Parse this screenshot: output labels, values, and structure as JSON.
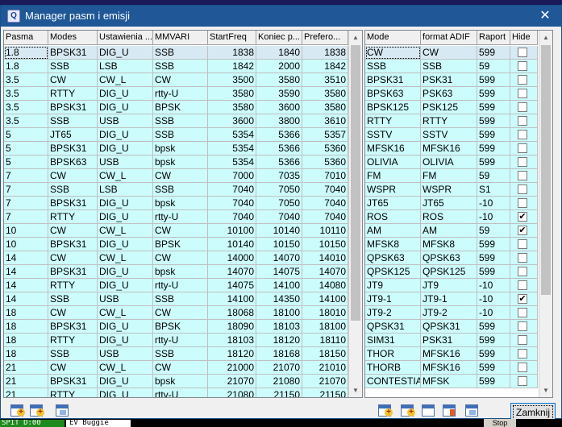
{
  "window": {
    "title": "Manager pasm i emisji"
  },
  "background": {
    "status_left": "SPIT D:00",
    "status_mid": "EV Buggie",
    "status_right": "Stop"
  },
  "left_table": {
    "columns": [
      "Pasma",
      "Modes",
      "Ustawienia ...",
      "MMVARI",
      "StartFreq",
      "Koniec p...",
      "Prefero..."
    ],
    "rows": [
      [
        "1.8",
        "BPSK31",
        "DIG_U",
        "SSB",
        "1838",
        "1840",
        "1838"
      ],
      [
        "1.8",
        "SSB",
        "LSB",
        "SSB",
        "1842",
        "2000",
        "1842"
      ],
      [
        "3.5",
        "CW",
        "CW_L",
        "CW",
        "3500",
        "3580",
        "3510"
      ],
      [
        "3.5",
        "RTTY",
        "DIG_U",
        "rtty-U",
        "3580",
        "3590",
        "3580"
      ],
      [
        "3.5",
        "BPSK31",
        "DIG_U",
        "BPSK",
        "3580",
        "3600",
        "3580"
      ],
      [
        "3.5",
        "SSB",
        "USB",
        "SSB",
        "3600",
        "3800",
        "3610"
      ],
      [
        "5",
        "JT65",
        "DIG_U",
        "SSB",
        "5354",
        "5366",
        "5357"
      ],
      [
        "5",
        "BPSK31",
        "DIG_U",
        "bpsk",
        "5354",
        "5366",
        "5360"
      ],
      [
        "5",
        "BPSK63",
        "USB",
        "bpsk",
        "5354",
        "5366",
        "5360"
      ],
      [
        "7",
        "CW",
        "CW_L",
        "CW",
        "7000",
        "7035",
        "7010"
      ],
      [
        "7",
        "SSB",
        "LSB",
        "SSB",
        "7040",
        "7050",
        "7040"
      ],
      [
        "7",
        "BPSK31",
        "DIG_U",
        "bpsk",
        "7040",
        "7050",
        "7040"
      ],
      [
        "7",
        "RTTY",
        "DIG_U",
        "rtty-U",
        "7040",
        "7040",
        "7040"
      ],
      [
        "10",
        "CW",
        "CW_L",
        "CW",
        "10100",
        "10140",
        "10110"
      ],
      [
        "10",
        "BPSK31",
        "DIG_U",
        "BPSK",
        "10140",
        "10150",
        "10150"
      ],
      [
        "14",
        "CW",
        "CW_L",
        "CW",
        "14000",
        "14070",
        "14010"
      ],
      [
        "14",
        "BPSK31",
        "DIG_U",
        "bpsk",
        "14070",
        "14075",
        "14070"
      ],
      [
        "14",
        "RTTY",
        "DIG_U",
        "rtty-U",
        "14075",
        "14100",
        "14080"
      ],
      [
        "14",
        "SSB",
        "USB",
        "SSB",
        "14100",
        "14350",
        "14100"
      ],
      [
        "18",
        "CW",
        "CW_L",
        "CW",
        "18068",
        "18100",
        "18010"
      ],
      [
        "18",
        "BPSK31",
        "DIG_U",
        "BPSK",
        "18090",
        "18103",
        "18100"
      ],
      [
        "18",
        "RTTY",
        "DIG_U",
        "rtty-U",
        "18103",
        "18120",
        "18110"
      ],
      [
        "18",
        "SSB",
        "USB",
        "SSB",
        "18120",
        "18168",
        "18150"
      ],
      [
        "21",
        "CW",
        "CW_L",
        "CW",
        "21000",
        "21070",
        "21010"
      ],
      [
        "21",
        "BPSK31",
        "DIG_U",
        "bpsk",
        "21070",
        "21080",
        "21070"
      ],
      [
        "21",
        "RTTY",
        "DIG_U",
        "rtty-U",
        "21080",
        "21150",
        "21150"
      ]
    ]
  },
  "right_table": {
    "columns": [
      "Mode",
      "format ADIF",
      "Raport",
      "Hide"
    ],
    "rows": [
      [
        "CW",
        "CW",
        "599",
        false
      ],
      [
        "SSB",
        "SSB",
        "59",
        false
      ],
      [
        "BPSK31",
        "PSK31",
        "599",
        false
      ],
      [
        "BPSK63",
        "PSK63",
        "599",
        false
      ],
      [
        "BPSK125",
        "PSK125",
        "599",
        false
      ],
      [
        "RTTY",
        "RTTY",
        "599",
        false
      ],
      [
        "SSTV",
        "SSTV",
        "599",
        false
      ],
      [
        "MFSK16",
        "MFSK16",
        "599",
        false
      ],
      [
        "OLIVIA",
        "OLIVIA",
        "599",
        false
      ],
      [
        "FM",
        "FM",
        "59",
        false
      ],
      [
        "WSPR",
        "WSPR",
        "S1",
        false
      ],
      [
        "JT65",
        "JT65",
        "-10",
        false
      ],
      [
        "ROS",
        "ROS",
        "-10",
        true
      ],
      [
        "AM",
        "AM",
        "59",
        true
      ],
      [
        "MFSK8",
        "MFSK8",
        "599",
        false
      ],
      [
        "QPSK63",
        "QPSK63",
        "599",
        false
      ],
      [
        "QPSK125",
        "QPSK125",
        "599",
        false
      ],
      [
        "JT9",
        "JT9",
        "-10",
        false
      ],
      [
        "JT9-1",
        "JT9-1",
        "-10",
        true
      ],
      [
        "JT9-2",
        "JT9-2",
        "-10",
        false
      ],
      [
        "QPSK31",
        "QPSK31",
        "599",
        false
      ],
      [
        "SIM31",
        "PSK31",
        "599",
        false
      ],
      [
        "THOR",
        "MFSK16",
        "599",
        false
      ],
      [
        "THORB",
        "MFSK16",
        "599",
        false
      ],
      [
        "CONTESTIA",
        "MFSK",
        "599",
        false
      ]
    ]
  },
  "buttons": {
    "close_label": "Zamknij"
  },
  "icons": {
    "left_toolbar": [
      "add-band-icon",
      "add-row-icon",
      "copy-icon"
    ],
    "right_toolbar": [
      "add-mode-icon",
      "add-icon",
      "grid-icon",
      "edit-icon",
      "refresh-icon"
    ]
  }
}
